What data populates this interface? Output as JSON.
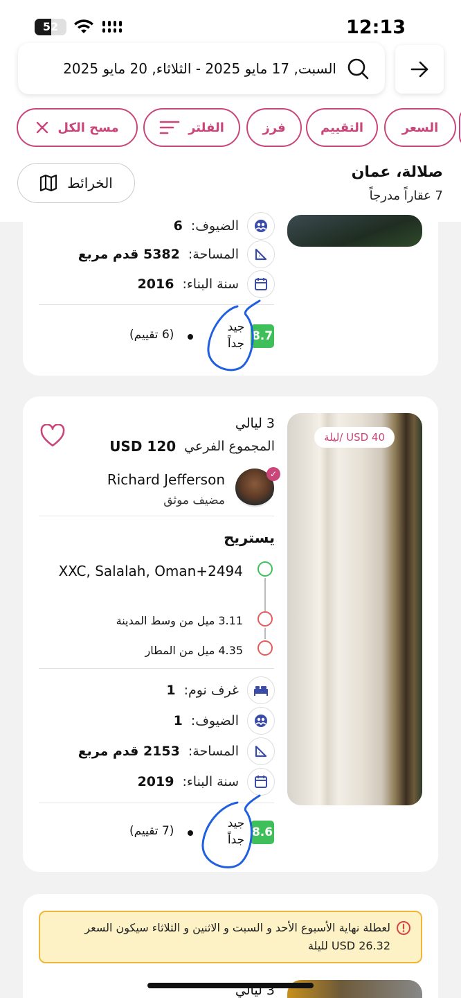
{
  "status": {
    "time": "12:13",
    "battery": "52",
    "battery_level": 0.52
  },
  "search": {
    "dates": "السبت, 17 مايو 2025 - الثلاثاء, 20 مايو 2025"
  },
  "chips": {
    "price": "السعر",
    "rating": "التقييم",
    "sort": "فرز",
    "filter": "الفلتر",
    "clear": "مسح الكل"
  },
  "location": {
    "title": "صلالة، عمان",
    "count": "7 عقاراً مدرجاً",
    "map": "الخرائط"
  },
  "card1": {
    "guests_label": "الضيوف:",
    "guests_value": "6",
    "area_label": "المساحة:",
    "area_value": "5382 قدم مربع",
    "year_label": "سنة البناء:",
    "year_value": "2016",
    "score": "8.7",
    "rating_line1": "جيد",
    "rating_line2": "جداً",
    "reviews": "(6 تقييم)"
  },
  "card2": {
    "nights": "3 ليالي",
    "subtotal_label": "المجموع الفرعي",
    "subtotal_value": "USD 120",
    "price_badge": "USD 40 /ليلة",
    "host_name": "Richard Jefferson",
    "host_status": "مضيف موثق",
    "title": "يستريح",
    "address": "XXC, Salalah, Oman+2494",
    "dist_center": "3.11 ميل من وسط المدينة",
    "dist_airport": "4.35 ميل من المطار",
    "bedrooms_label": "غرف نوم:",
    "bedrooms_value": "1",
    "guests_label": "الضيوف:",
    "guests_value": "1",
    "area_label": "المساحة:",
    "area_value": "2153 قدم مربع",
    "year_label": "سنة البناء:",
    "year_value": "2019",
    "score": "8.6",
    "rating_line1": "جيد",
    "rating_line2": "جداً",
    "reviews": "(7 تقييم)"
  },
  "card3": {
    "notice_line1": "لعطلة نهاية الأسبوع الأحد و السبت و الاثنين و الثلاثاء سيكون السعر",
    "notice_line2": "USD 26.32 لليلة",
    "nights": "3 ليالي"
  },
  "colors": {
    "accent": "#c9457a",
    "score": "#3fbf5a",
    "notice_bg": "#fdf2c6",
    "notice_border": "#f0b63a"
  }
}
